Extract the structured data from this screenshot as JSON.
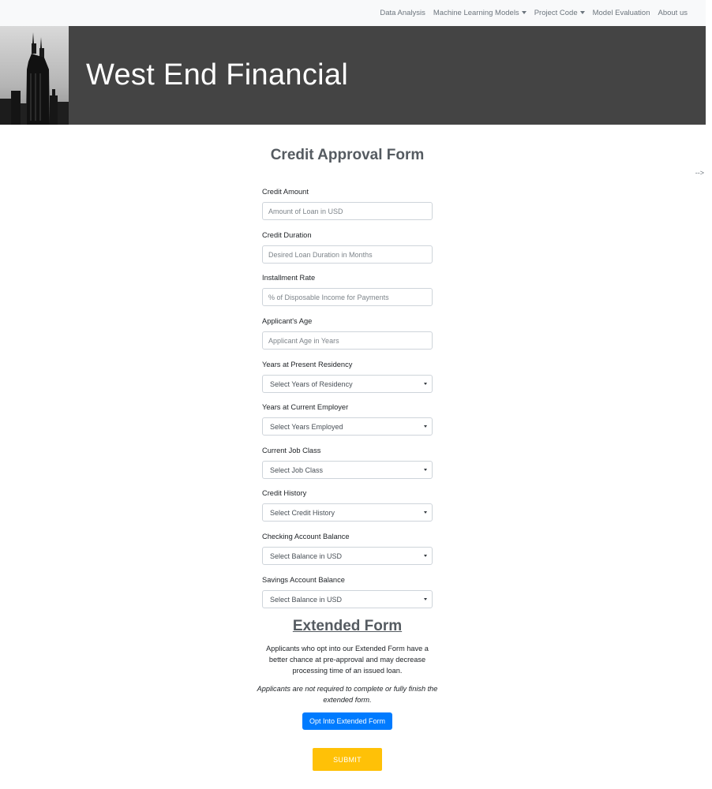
{
  "nav": {
    "items": [
      {
        "label": "Data Analysis",
        "dropdown": false
      },
      {
        "label": "Machine Learning Models",
        "dropdown": true
      },
      {
        "label": "Project Code",
        "dropdown": true
      },
      {
        "label": "Model Evaluation",
        "dropdown": false
      },
      {
        "label": "About us",
        "dropdown": false
      }
    ]
  },
  "header": {
    "title": "West End Financial"
  },
  "stray_text": "-->",
  "form": {
    "title": "Credit Approval Form",
    "fields": [
      {
        "label": "Credit Amount",
        "type": "input",
        "placeholder": "Amount of Loan in USD"
      },
      {
        "label": "Credit Duration",
        "type": "input",
        "placeholder": "Desired Loan Duration in Months"
      },
      {
        "label": "Installment Rate",
        "type": "input",
        "placeholder": "% of Disposable Income for Payments"
      },
      {
        "label": "Applicant's Age",
        "type": "input",
        "placeholder": "Applicant Age in Years"
      },
      {
        "label": "Years at Present Residency",
        "type": "select",
        "value": "Select Years of Residency"
      },
      {
        "label": "Years at Current Employer",
        "type": "select",
        "value": "Select Years Employed"
      },
      {
        "label": "Current Job Class",
        "type": "select",
        "value": "Select Job Class"
      },
      {
        "label": "Credit History",
        "type": "select",
        "value": "Select Credit History"
      },
      {
        "label": "Checking Account Balance",
        "type": "select",
        "value": "Select Balance in USD"
      },
      {
        "label": "Savings Account Balance",
        "type": "select",
        "value": "Select Balance in USD"
      }
    ]
  },
  "extended": {
    "title": "Extended Form",
    "description": "Applicants who opt into our Extended Form have a better chance at pre-approval and may decrease processing time of an issued loan.",
    "note": "Applicants are not required to complete or fully finish the extended form.",
    "button_label": "Opt Into Extended Form"
  },
  "submit_label": "SUBMIT",
  "colors": {
    "navbar_bg": "#f8f9fa",
    "banner_bg": "#444444",
    "primary_button": "#007bff",
    "submit_button": "#ffc107",
    "heading": "#555b61"
  }
}
